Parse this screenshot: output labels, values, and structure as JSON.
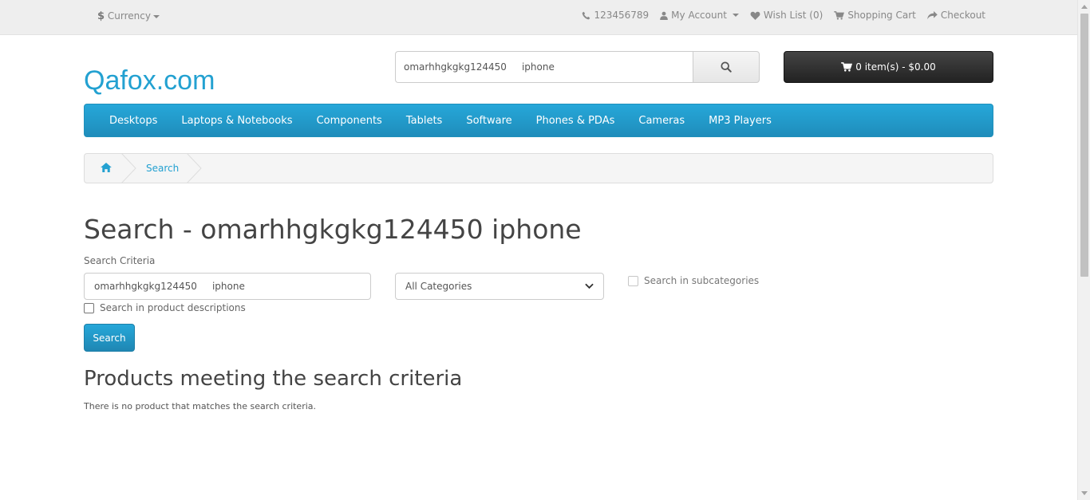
{
  "topbar": {
    "currency_symbol": "$",
    "currency_label": "Currency",
    "phone": "123456789",
    "my_account": "My Account",
    "wishlist": "Wish List (0)",
    "shopping_cart": "Shopping Cart",
    "checkout": "Checkout"
  },
  "header": {
    "logo": "Qafox.com",
    "search_value": "omarhhgkgkg124450     iphone",
    "cart_label": "0 item(s) - $0.00"
  },
  "menu": {
    "items": [
      "Desktops",
      "Laptops & Notebooks",
      "Components",
      "Tablets",
      "Software",
      "Phones & PDAs",
      "Cameras",
      "MP3 Players"
    ]
  },
  "breadcrumb": {
    "current": "Search"
  },
  "content": {
    "title": "Search - omarhhgkgkg124450 iphone",
    "criteria_label": "Search Criteria",
    "criteria_value": "omarhhgkgkg124450     iphone",
    "category_selected": "All Categories",
    "subcategories_label": "Search in subcategories",
    "descriptions_label": "Search in product descriptions",
    "search_button": "Search",
    "results_heading": "Products meeting the search criteria",
    "no_results": "There is no product that matches the search criteria."
  },
  "colors": {
    "accent": "#23a1d1",
    "cart_bg": "#222222"
  }
}
